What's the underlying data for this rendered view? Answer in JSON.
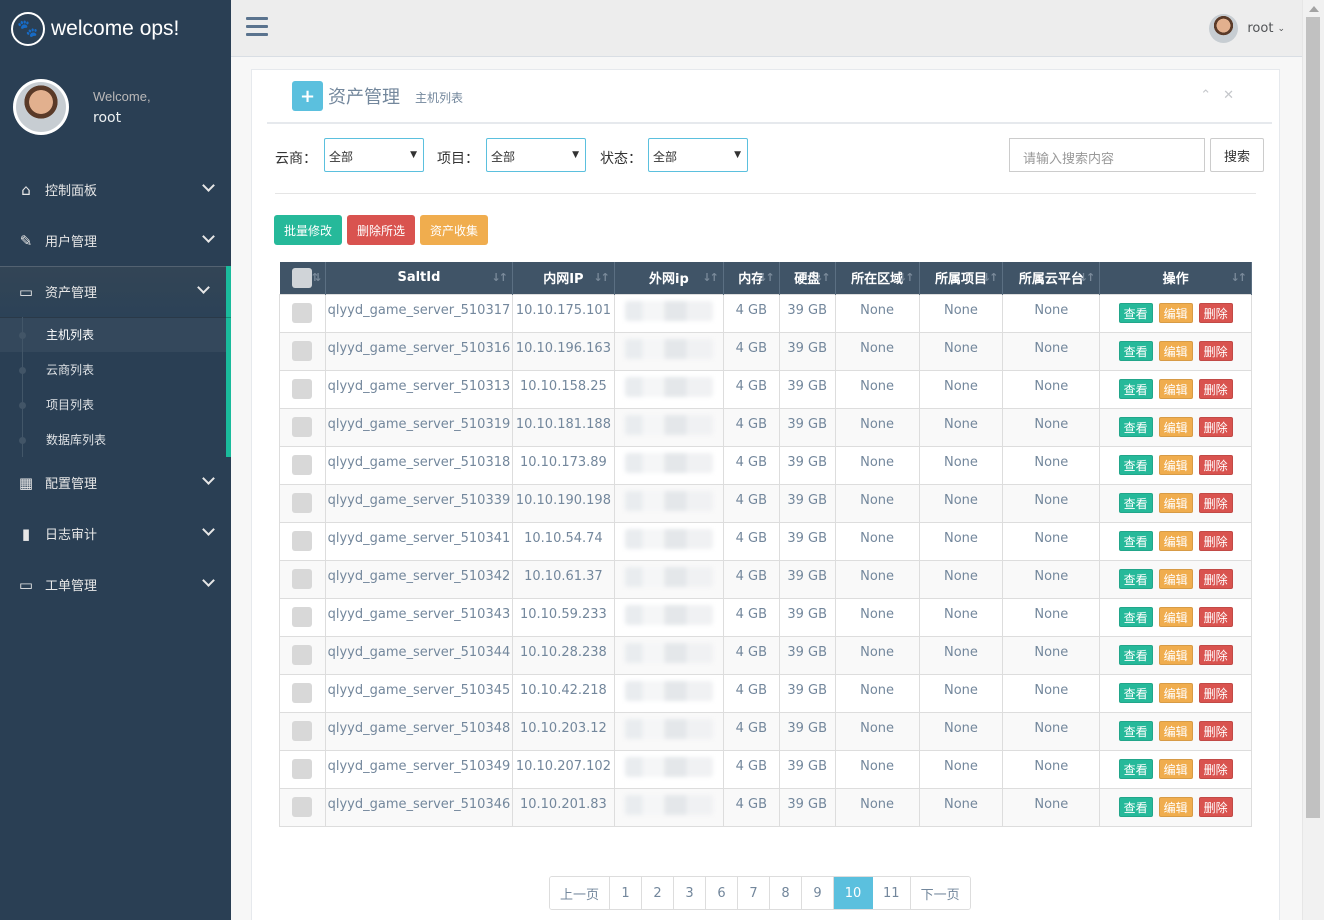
{
  "brand": {
    "title": "welcome ops!",
    "icon": "paw-icon"
  },
  "profile": {
    "welcome": "Welcome,",
    "name": "root"
  },
  "sidebar": {
    "items": [
      {
        "label": "控制面板",
        "icon": "home-icon",
        "glyph": "⌂"
      },
      {
        "label": "用户管理",
        "icon": "edit-icon",
        "glyph": "✎"
      },
      {
        "label": "资产管理",
        "icon": "desktop-icon",
        "glyph": "▭"
      },
      {
        "label": "配置管理",
        "icon": "table-icon",
        "glyph": "▦"
      },
      {
        "label": "日志审计",
        "icon": "bar-chart-icon",
        "glyph": "▮"
      },
      {
        "label": "工单管理",
        "icon": "laptop-icon",
        "glyph": "▭"
      }
    ],
    "subitems": [
      "主机列表",
      "云商列表",
      "项目列表",
      "数据库列表"
    ]
  },
  "topnav": {
    "user": "root"
  },
  "panel": {
    "title": "资产管理",
    "subtitle": "主机列表",
    "plus": "+"
  },
  "filters": {
    "cloud_label": "云商：",
    "cloud_value": "全部",
    "project_label": "项目：",
    "project_value": "全部",
    "status_label": "状态：",
    "status_value": "全部",
    "search_placeholder": "请输入搜索内容",
    "search_button": "搜索"
  },
  "actions": {
    "batch_edit": "批量修改",
    "delete_selected": "删除所选",
    "collect": "资产收集"
  },
  "colors": {
    "success": "#26b99a",
    "danger": "#d9534f",
    "warning": "#f0ad4e",
    "info": "#5bc0de",
    "header": "#405467",
    "sidebar": "#2a3f54"
  },
  "table": {
    "headers": [
      "SaltId",
      "内网IP",
      "外网ip",
      "内存",
      "硬盘",
      "所在区域",
      "所属项目",
      "所属云平台",
      "操作"
    ],
    "row_buttons": {
      "view": "查看",
      "edit": "编辑",
      "delete": "删除"
    },
    "rows": [
      {
        "salt": "qlyyd_game_server_510317",
        "ip": "10.10.175.101",
        "mem": "4 GB",
        "disk": "39 GB",
        "region": "None",
        "project": "None",
        "cloud": "None"
      },
      {
        "salt": "qlyyd_game_server_510316",
        "ip": "10.10.196.163",
        "mem": "4 GB",
        "disk": "39 GB",
        "region": "None",
        "project": "None",
        "cloud": "None"
      },
      {
        "salt": "qlyyd_game_server_510313",
        "ip": "10.10.158.25",
        "mem": "4 GB",
        "disk": "39 GB",
        "region": "None",
        "project": "None",
        "cloud": "None"
      },
      {
        "salt": "qlyyd_game_server_510319",
        "ip": "10.10.181.188",
        "mem": "4 GB",
        "disk": "39 GB",
        "region": "None",
        "project": "None",
        "cloud": "None"
      },
      {
        "salt": "qlyyd_game_server_510318",
        "ip": "10.10.173.89",
        "mem": "4 GB",
        "disk": "39 GB",
        "region": "None",
        "project": "None",
        "cloud": "None"
      },
      {
        "salt": "qlyyd_game_server_510339",
        "ip": "10.10.190.198",
        "mem": "4 GB",
        "disk": "39 GB",
        "region": "None",
        "project": "None",
        "cloud": "None"
      },
      {
        "salt": "qlyyd_game_server_510341",
        "ip": "10.10.54.74",
        "mem": "4 GB",
        "disk": "39 GB",
        "region": "None",
        "project": "None",
        "cloud": "None"
      },
      {
        "salt": "qlyyd_game_server_510342",
        "ip": "10.10.61.37",
        "mem": "4 GB",
        "disk": "39 GB",
        "region": "None",
        "project": "None",
        "cloud": "None"
      },
      {
        "salt": "qlyyd_game_server_510343",
        "ip": "10.10.59.233",
        "mem": "4 GB",
        "disk": "39 GB",
        "region": "None",
        "project": "None",
        "cloud": "None"
      },
      {
        "salt": "qlyyd_game_server_510344",
        "ip": "10.10.28.238",
        "mem": "4 GB",
        "disk": "39 GB",
        "region": "None",
        "project": "None",
        "cloud": "None"
      },
      {
        "salt": "qlyyd_game_server_510345",
        "ip": "10.10.42.218",
        "mem": "4 GB",
        "disk": "39 GB",
        "region": "None",
        "project": "None",
        "cloud": "None"
      },
      {
        "salt": "qlyyd_game_server_510348",
        "ip": "10.10.203.12",
        "mem": "4 GB",
        "disk": "39 GB",
        "region": "None",
        "project": "None",
        "cloud": "None"
      },
      {
        "salt": "qlyyd_game_server_510349",
        "ip": "10.10.207.102",
        "mem": "4 GB",
        "disk": "39 GB",
        "region": "None",
        "project": "None",
        "cloud": "None"
      },
      {
        "salt": "qlyyd_game_server_510346",
        "ip": "10.10.201.83",
        "mem": "4 GB",
        "disk": "39 GB",
        "region": "None",
        "project": "None",
        "cloud": "None"
      }
    ]
  },
  "pagination": {
    "prev": "上一页",
    "pages": [
      "1",
      "2",
      "3",
      "6",
      "7",
      "8",
      "9",
      "10",
      "11"
    ],
    "current": "10",
    "next": "下一页"
  }
}
